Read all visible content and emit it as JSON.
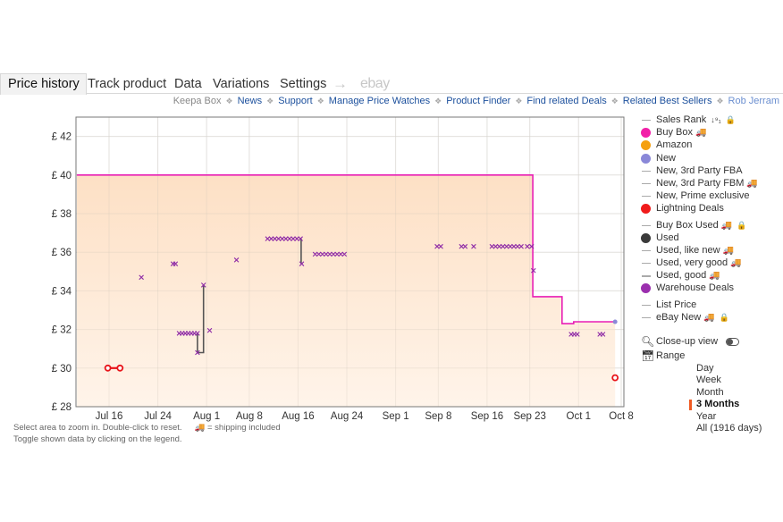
{
  "tabs": [
    {
      "label": "Price history",
      "active": true
    },
    {
      "label": "Track product",
      "active": false
    },
    {
      "label": "Data",
      "active": false
    },
    {
      "label": "Variations",
      "active": false
    },
    {
      "label": "Settings",
      "active": false
    }
  ],
  "tab_arrow": "→",
  "tab_ebay": "ebay",
  "links": {
    "keepa_box": "Keepa Box",
    "news": "News",
    "support": "Support",
    "manage_price_watches": "Manage Price Watches",
    "product_finder": "Product Finder",
    "find_related_deals": "Find related Deals",
    "related_best_sellers": "Related Best Sellers",
    "user": "Rob Jerram",
    "separator": "❖"
  },
  "legend": {
    "items": [
      {
        "label": "Sales Rank",
        "marker": "dash",
        "color": "#aaaaaa",
        "suffix_icons": [
          "sort-icon",
          "lock-icon"
        ]
      },
      {
        "label": "Buy Box",
        "marker": "dot",
        "color": "#f21fa8",
        "truck": true
      },
      {
        "label": "Amazon",
        "marker": "dot",
        "color": "#f5a00e"
      },
      {
        "label": "New",
        "marker": "dot",
        "color": "#8a88d8"
      },
      {
        "label": "New, 3rd Party FBA",
        "marker": "dash",
        "color": "#aaaaaa"
      },
      {
        "label": "New, 3rd Party FBM",
        "marker": "dash",
        "color": "#aaaaaa",
        "truck": true
      },
      {
        "label": "New, Prime exclusive",
        "marker": "dash",
        "color": "#aaaaaa"
      },
      {
        "label": "Lightning Deals",
        "marker": "dot",
        "color": "#f01b1b"
      },
      {
        "label": "Buy Box Used",
        "marker": "dash",
        "color": "#aaaaaa",
        "truck": true,
        "lock": true,
        "gap_before": true
      },
      {
        "label": "Used",
        "marker": "dot",
        "color": "#3a3a3a"
      },
      {
        "label": "Used, like new",
        "marker": "dash",
        "color": "#aaaaaa",
        "truck": true
      },
      {
        "label": "Used, very good",
        "marker": "dash",
        "color": "#aaaaaa",
        "truck": true
      },
      {
        "label": "Used, good",
        "marker": "dash",
        "color": "#aaaaaa",
        "truck": true
      },
      {
        "label": "Warehouse Deals",
        "marker": "dot",
        "color": "#9b2fae"
      },
      {
        "label": "List Price",
        "marker": "dash",
        "color": "#aaaaaa",
        "gap_before": true
      },
      {
        "label": "eBay New",
        "marker": "dash",
        "color": "#aaaaaa",
        "truck": true,
        "lock": true
      }
    ],
    "truck_glyph": "🚚",
    "lock_glyph": "🔒",
    "sort_glyph": "↓⁹₁"
  },
  "tools": {
    "closeup_label": "Close-up view",
    "range_label": "Range",
    "range_options": [
      "Day",
      "Week",
      "Month",
      "3 Months",
      "Year",
      "All (1916 days)"
    ],
    "range_selected": "3 Months"
  },
  "footer": {
    "line1": "Select area to zoom in. Double-click to reset.",
    "shipping_note": "= shipping included",
    "line2": "Toggle shown data by clicking on the legend."
  },
  "colors": {
    "buy_box": "#e81fb5",
    "warehouse": "#8e2aa6",
    "lightning": "#e8151b",
    "used_line": "#555555",
    "fill_top": "#fde2c9",
    "fill_bottom": "#fff3e7",
    "accent": "#f05a22"
  },
  "chart_data": {
    "type": "line",
    "title": "",
    "xlabel": "",
    "ylabel": "",
    "currency": "£",
    "x_domain_days": [
      0,
      87
    ],
    "x_ticks": [
      {
        "label": "Jul 16",
        "day": 5
      },
      {
        "label": "Jul 24",
        "day": 13
      },
      {
        "label": "Aug 1",
        "day": 21
      },
      {
        "label": "Aug 8",
        "day": 28
      },
      {
        "label": "Aug 16",
        "day": 36
      },
      {
        "label": "Aug 24",
        "day": 44
      },
      {
        "label": "Sep 1",
        "day": 52
      },
      {
        "label": "Sep 8",
        "day": 59
      },
      {
        "label": "Sep 16",
        "day": 67
      },
      {
        "label": "Sep 23",
        "day": 74
      },
      {
        "label": "Oct 1",
        "day": 82
      },
      {
        "label": "Oct 8",
        "day": 89
      }
    ],
    "ylim": [
      28,
      43
    ],
    "y_ticks": [
      28,
      30,
      32,
      34,
      36,
      38,
      40,
      42
    ],
    "y_tick_labels": [
      "£ 28",
      "£ 30",
      "£ 32",
      "£ 34",
      "£ 36",
      "£ 38",
      "£ 40",
      "£ 42"
    ],
    "grid": true,
    "series": [
      {
        "name": "Buy Box",
        "kind": "step-area",
        "points": [
          [
            0,
            40
          ],
          [
            74.5,
            40
          ],
          [
            74.5,
            33.7
          ],
          [
            79.3,
            33.7
          ],
          [
            79.3,
            32.3
          ],
          [
            81.2,
            32.3
          ],
          [
            81.2,
            32.4
          ],
          [
            88,
            32.4
          ]
        ]
      },
      {
        "name": "Lightning Deals",
        "kind": "segments",
        "segments": [
          [
            [
              4.8,
              30.0
            ],
            [
              6.8,
              30.0
            ]
          ]
        ],
        "points": [
          [
            88,
            29.5
          ]
        ]
      },
      {
        "name": "Used",
        "kind": "step-line",
        "segments": [
          [
            [
              19.5,
              31.8
            ],
            [
              19.5,
              30.8
            ],
            [
              20.5,
              30.8
            ],
            [
              20.5,
              34.3
            ]
          ],
          [
            [
              36.5,
              36.7
            ],
            [
              36.5,
              35.4
            ]
          ]
        ]
      },
      {
        "name": "Warehouse Deals",
        "kind": "markers",
        "points": [
          [
            10.3,
            34.7
          ],
          [
            15.5,
            35.4
          ],
          [
            15.9,
            35.4
          ],
          [
            16.5,
            31.8
          ],
          [
            17.0,
            31.8
          ],
          [
            17.5,
            31.8
          ],
          [
            18.0,
            31.8
          ],
          [
            18.5,
            31.8
          ],
          [
            19.0,
            31.8
          ],
          [
            19.5,
            31.8
          ],
          [
            19.5,
            30.8
          ],
          [
            20.5,
            34.3
          ],
          [
            21.5,
            31.95
          ],
          [
            25.9,
            35.6
          ],
          [
            31.0,
            36.7
          ],
          [
            31.6,
            36.7
          ],
          [
            32.2,
            36.7
          ],
          [
            32.8,
            36.7
          ],
          [
            33.4,
            36.7
          ],
          [
            34.0,
            36.7
          ],
          [
            34.6,
            36.7
          ],
          [
            35.2,
            36.7
          ],
          [
            35.8,
            36.7
          ],
          [
            36.4,
            36.7
          ],
          [
            36.6,
            35.4
          ],
          [
            38.8,
            35.9
          ],
          [
            39.4,
            35.9
          ],
          [
            40.0,
            35.9
          ],
          [
            40.6,
            35.9
          ],
          [
            41.2,
            35.9
          ],
          [
            41.8,
            35.9
          ],
          [
            42.4,
            35.9
          ],
          [
            43.0,
            35.9
          ],
          [
            43.6,
            35.9
          ],
          [
            58.8,
            36.3
          ],
          [
            59.4,
            36.3
          ],
          [
            62.8,
            36.3
          ],
          [
            63.4,
            36.3
          ],
          [
            64.8,
            36.3
          ],
          [
            67.8,
            36.3
          ],
          [
            68.4,
            36.3
          ],
          [
            69.0,
            36.3
          ],
          [
            69.6,
            36.3
          ],
          [
            70.2,
            36.3
          ],
          [
            70.8,
            36.3
          ],
          [
            71.4,
            36.3
          ],
          [
            72.0,
            36.3
          ],
          [
            72.6,
            36.3
          ],
          [
            73.6,
            36.3
          ],
          [
            74.3,
            36.3
          ],
          [
            74.6,
            35.05
          ],
          [
            80.8,
            31.75
          ],
          [
            81.3,
            31.75
          ],
          [
            81.8,
            31.75
          ],
          [
            85.5,
            31.75
          ],
          [
            86.0,
            31.75
          ]
        ]
      }
    ],
    "legend_position": "right"
  }
}
